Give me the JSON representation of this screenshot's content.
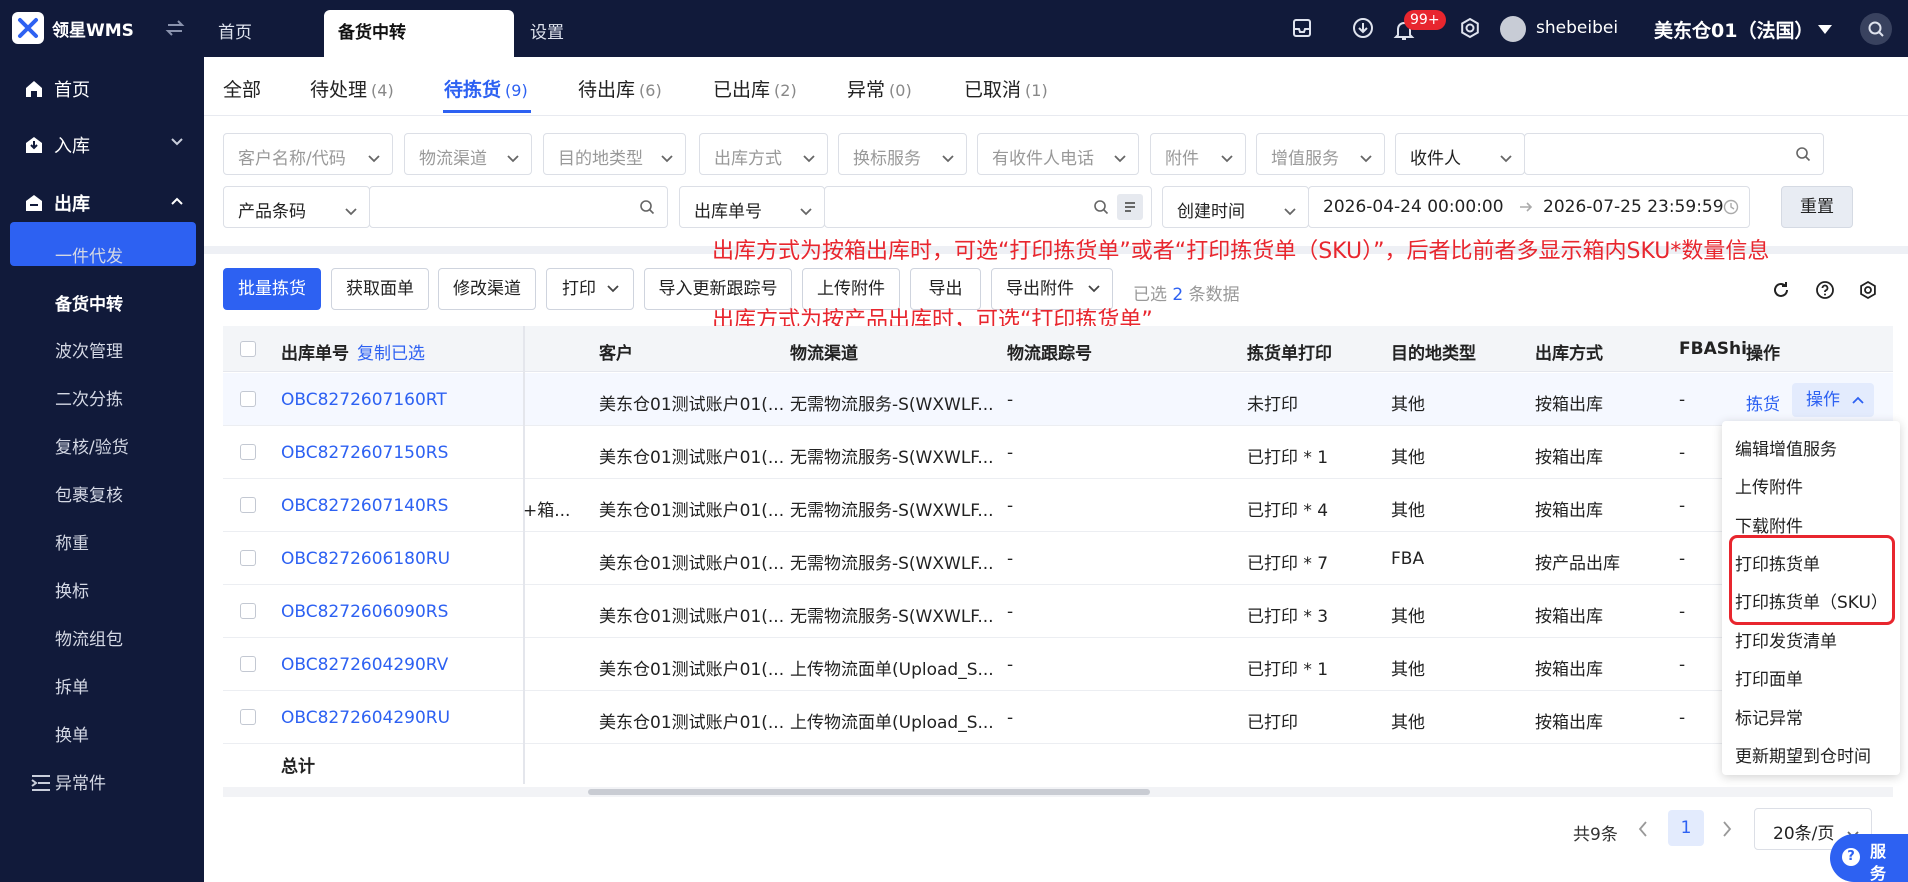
{
  "app": {
    "brand": "领星WMS"
  },
  "topnav": {
    "tabs": [
      {
        "label": "首页"
      },
      {
        "label": "备货中转"
      },
      {
        "label": "设置"
      }
    ],
    "notification_badge": "99+",
    "username": "shebeibei",
    "warehouse": "美东仓01（法国）"
  },
  "sidebar": {
    "home": "首页",
    "inbound": "入库",
    "outbound": "出库",
    "sub_items": [
      "一件代发",
      "备货中转",
      "波次管理",
      "二次分拣",
      "复核/验货",
      "包裹复核",
      "称重",
      "换标",
      "物流组包",
      "拆单",
      "换单",
      "异常件"
    ]
  },
  "status_tabs": [
    {
      "label": "全部",
      "count": ""
    },
    {
      "label": "待处理",
      "count": "(4)"
    },
    {
      "label": "待拣货",
      "count": "(9)"
    },
    {
      "label": "待出库",
      "count": "(6)"
    },
    {
      "label": "已出库",
      "count": "(2)"
    },
    {
      "label": "异常",
      "count": "(0)"
    },
    {
      "label": "已取消",
      "count": "(1)"
    }
  ],
  "filters": {
    "row1": [
      "客户名称/代码",
      "物流渠道",
      "目的地类型",
      "出库方式",
      "换标服务",
      "有收件人电话",
      "附件",
      "增值服务"
    ],
    "recipient_select": "收件人",
    "product_code_select": "产品条码",
    "order_no_select": "出库单号",
    "created_time_select": "创建时间",
    "date_start": "2026-04-24 00:00:00",
    "date_end": "2026-07-25 23:59:59",
    "reset": "重置"
  },
  "toolbar": {
    "buttons": [
      "批量拣货",
      "获取面单",
      "修改渠道",
      "打印",
      "导入更新跟踪号",
      "上传附件",
      "导出",
      "导出附件"
    ],
    "selected_prefix": "已选",
    "selected_count": "2",
    "selected_suffix": "条数据"
  },
  "notes": {
    "line1": "出库方式为按箱出库时，可选“打印拣货单”或者“打印拣货单（SKU）”，后者比前者多显示箱内SKU*数量信息",
    "line2": "出库方式为按产品出库时，可选“打印拣货单”"
  },
  "table": {
    "headers": {
      "order_no": "出库单号",
      "copy_selected": "复制已选",
      "customer": "客户",
      "channel": "物流渠道",
      "tracking": "物流跟踪号",
      "pick_print": "拣货单打印",
      "dest_type": "目的地类型",
      "method": "出库方式",
      "fba": "FBAShi",
      "ops": "操作"
    },
    "rows": [
      {
        "order_no": "OBC8272607160RT",
        "extra": "",
        "customer": "美东仓01测试账户01(...",
        "channel": "无需物流服务-S(WXWLF...",
        "tracking": "-",
        "pick_print": "未打印",
        "dest": "其他",
        "method": "按箱出库",
        "fba": "-"
      },
      {
        "order_no": "OBC8272607150RS",
        "extra": "",
        "customer": "美东仓01测试账户01(...",
        "channel": "无需物流服务-S(WXWLF...",
        "tracking": "-",
        "pick_print": "已打印 * 1",
        "dest": "其他",
        "method": "按箱出库",
        "fba": "-"
      },
      {
        "order_no": "OBC8272607140RS",
        "extra": "+箱...",
        "customer": "美东仓01测试账户01(...",
        "channel": "无需物流服务-S(WXWLF...",
        "tracking": "-",
        "pick_print": "已打印 * 4",
        "dest": "其他",
        "method": "按箱出库",
        "fba": "-"
      },
      {
        "order_no": "OBC8272606180RU",
        "extra": "",
        "customer": "美东仓01测试账户01(...",
        "channel": "无需物流服务-S(WXWLF...",
        "tracking": "-",
        "pick_print": "已打印 * 7",
        "dest": "FBA",
        "method": "按产品出库",
        "fba": "-"
      },
      {
        "order_no": "OBC8272606090RS",
        "extra": "",
        "customer": "美东仓01测试账户01(...",
        "channel": "无需物流服务-S(WXWLF...",
        "tracking": "-",
        "pick_print": "已打印 * 3",
        "dest": "其他",
        "method": "按箱出库",
        "fba": "-"
      },
      {
        "order_no": "OBC8272604290RV",
        "extra": "",
        "customer": "美东仓01测试账户01(...",
        "channel": "上传物流面单(Upload_S...",
        "tracking": "-",
        "pick_print": "已打印 * 1",
        "dest": "其他",
        "method": "按箱出库",
        "fba": "-"
      },
      {
        "order_no": "OBC8272604290RU",
        "extra": "",
        "customer": "美东仓01测试账户01(...",
        "channel": "上传物流面单(Upload_S...",
        "tracking": "-",
        "pick_print": "已打印",
        "dest": "其他",
        "method": "按箱出库",
        "fba": "-"
      }
    ],
    "total_label": "总计",
    "row_actions": {
      "pick": "拣货",
      "more": "操作"
    }
  },
  "dropdown": {
    "items": [
      "编辑增值服务",
      "上传附件",
      "下载附件",
      "打印拣货单",
      "打印拣货单（SKU）",
      "打印发货清单",
      "打印面单",
      "标记异常",
      "更新期望到仓时间"
    ]
  },
  "pagination": {
    "total": "共9条",
    "current": "1",
    "page_size": "20条/页"
  },
  "service": {
    "label1": "服",
    "label2": "务"
  },
  "colors": {
    "primary": "#2d61f2",
    "nav_bg": "#111a3a",
    "annotation": "#e8262e"
  }
}
